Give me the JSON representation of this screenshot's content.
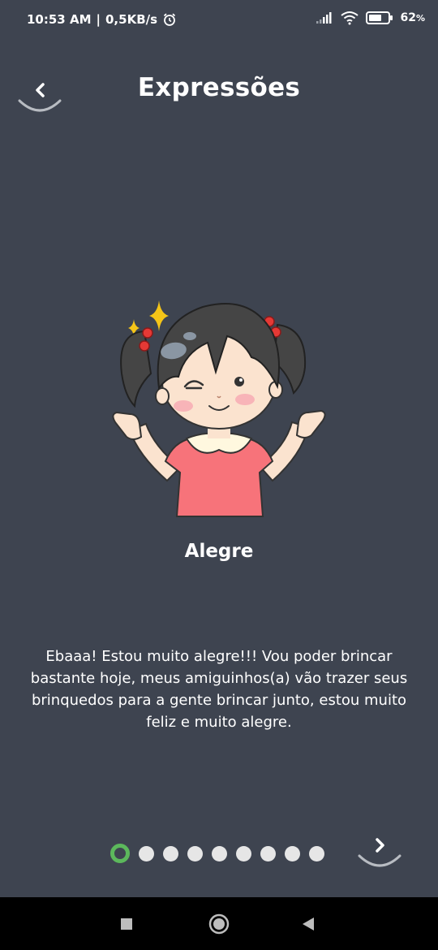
{
  "status_bar": {
    "time": "10:53 AM",
    "separator": "|",
    "network_speed": "0,5KB/s",
    "battery_percent": "62",
    "battery_unit": "%"
  },
  "header": {
    "title": "Expressões"
  },
  "expression": {
    "name": "Alegre",
    "description": "Ebaaa! Estou muito alegre!!! Vou poder brincar bastante hoje, meus amiguinhos(a) vão trazer seus brinquedos para a gente brincar junto, estou muito feliz e muito alegre."
  },
  "pager": {
    "current_page": 1,
    "total_pages": 9
  },
  "colors": {
    "background": "#3e4450",
    "active_dot": "#5cb85c",
    "inactive_dot": "#e6e6e6"
  },
  "icons": {
    "back": "chevron-left-icon",
    "next": "chevron-right-icon",
    "nav_recents": "square-icon",
    "nav_home": "circle-icon",
    "nav_back": "triangle-back-icon"
  }
}
